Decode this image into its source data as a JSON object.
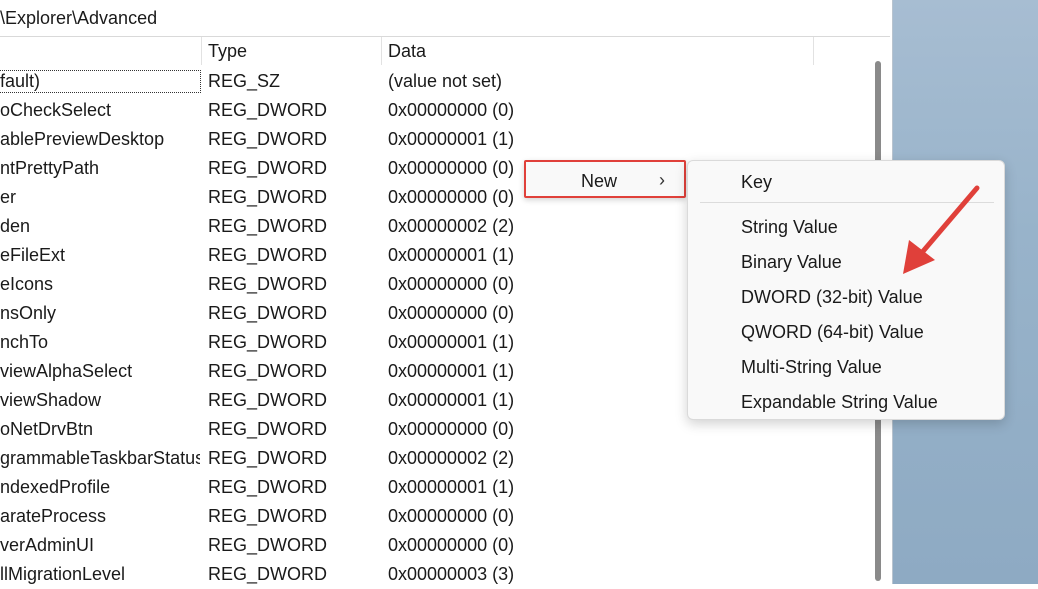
{
  "address": {
    "path": "\\Explorer\\Advanced"
  },
  "columns": {
    "type": "Type",
    "data": "Data"
  },
  "rows": [
    {
      "name": "fault)",
      "type": "REG_SZ",
      "data": "(value not set)"
    },
    {
      "name": "oCheckSelect",
      "type": "REG_DWORD",
      "data": "0x00000000 (0)"
    },
    {
      "name": "ablePreviewDesktop",
      "type": "REG_DWORD",
      "data": "0x00000001 (1)"
    },
    {
      "name": "ntPrettyPath",
      "type": "REG_DWORD",
      "data": "0x00000000 (0)"
    },
    {
      "name": "er",
      "type": "REG_DWORD",
      "data": "0x00000000 (0)"
    },
    {
      "name": "den",
      "type": "REG_DWORD",
      "data": "0x00000002 (2)"
    },
    {
      "name": "eFileExt",
      "type": "REG_DWORD",
      "data": "0x00000001 (1)"
    },
    {
      "name": "eIcons",
      "type": "REG_DWORD",
      "data": "0x00000000 (0)"
    },
    {
      "name": "nsOnly",
      "type": "REG_DWORD",
      "data": "0x00000000 (0)"
    },
    {
      "name": "nchTo",
      "type": "REG_DWORD",
      "data": "0x00000001 (1)"
    },
    {
      "name": "viewAlphaSelect",
      "type": "REG_DWORD",
      "data": "0x00000001 (1)"
    },
    {
      "name": "viewShadow",
      "type": "REG_DWORD",
      "data": "0x00000001 (1)"
    },
    {
      "name": "oNetDrvBtn",
      "type": "REG_DWORD",
      "data": "0x00000000 (0)"
    },
    {
      "name": "grammableTaskbarStatus",
      "type": "REG_DWORD",
      "data": "0x00000002 (2)"
    },
    {
      "name": "ndexedProfile",
      "type": "REG_DWORD",
      "data": "0x00000001 (1)"
    },
    {
      "name": "arateProcess",
      "type": "REG_DWORD",
      "data": "0x00000000 (0)"
    },
    {
      "name": "verAdminUI",
      "type": "REG_DWORD",
      "data": "0x00000000 (0)"
    },
    {
      "name": "llMigrationLevel",
      "type": "REG_DWORD",
      "data": "0x00000003 (3)"
    }
  ],
  "context_menu": {
    "new_label": "New",
    "chevron": "›"
  },
  "submenu": {
    "items": [
      "Key",
      "String Value",
      "Binary Value",
      "DWORD (32-bit) Value",
      "QWORD (64-bit) Value",
      "Multi-String Value",
      "Expandable String Value"
    ]
  },
  "colors": {
    "highlight_border": "#e0403a",
    "annotation_arrow": "#e0403a",
    "desktop": "#98b3ca"
  },
  "icons": {
    "submenu_chevron": "chevron-right-icon",
    "annotation": "red-arrow-icon"
  }
}
